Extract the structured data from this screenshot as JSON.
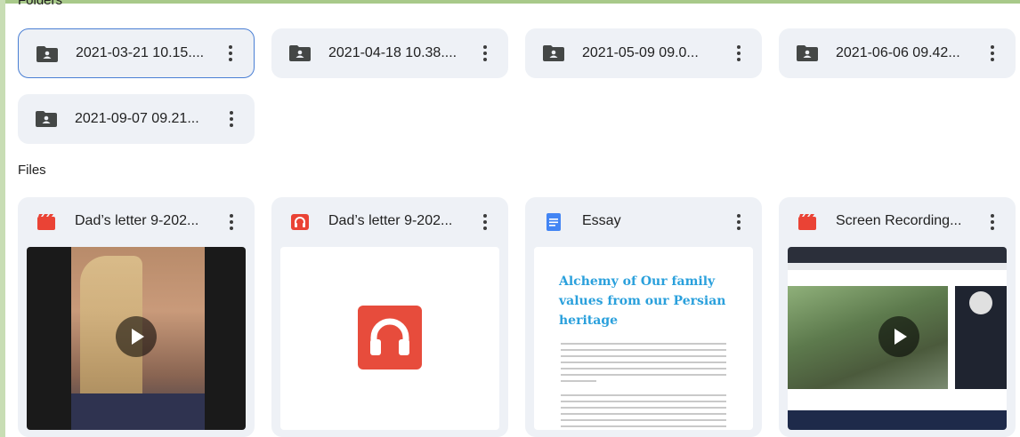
{
  "sections": {
    "folders_label": "Folders",
    "files_label": "Files"
  },
  "folders": [
    {
      "name": "2021-03-21 10.15....",
      "icon": "shared-folder-icon",
      "selected": true
    },
    {
      "name": "2021-04-18 10.38....",
      "icon": "shared-folder-icon"
    },
    {
      "name": "2021-05-09 09.0...",
      "icon": "shared-folder-icon"
    },
    {
      "name": "2021-06-06 09.42...",
      "icon": "shared-folder-icon"
    },
    {
      "name": "2021-09-07 09.21...",
      "icon": "shared-folder-icon"
    }
  ],
  "files": [
    {
      "name": "Dad’s letter 9-202...",
      "icon": "video-file-icon",
      "icon_color": "#ea4335",
      "thumbnail": "video-preview"
    },
    {
      "name": "Dad’s letter 9-202...",
      "icon": "audio-file-icon",
      "icon_color": "#ea4335",
      "thumbnail": "audio-preview"
    },
    {
      "name": "Essay",
      "icon": "docs-file-icon",
      "icon_color": "#4285f4",
      "thumbnail": "document-preview",
      "preview_title": "Alchemy of Our family values from our Persian heritage"
    },
    {
      "name": "Screen Recording...",
      "icon": "video-file-icon",
      "icon_color": "#ea4335",
      "thumbnail": "screen-recording-preview"
    }
  ],
  "colors": {
    "card_bg": "#eef1f6",
    "selected_border": "#4a7fd4",
    "essay_title": "#2aa0dc",
    "audio_tile": "#e74c3c"
  }
}
